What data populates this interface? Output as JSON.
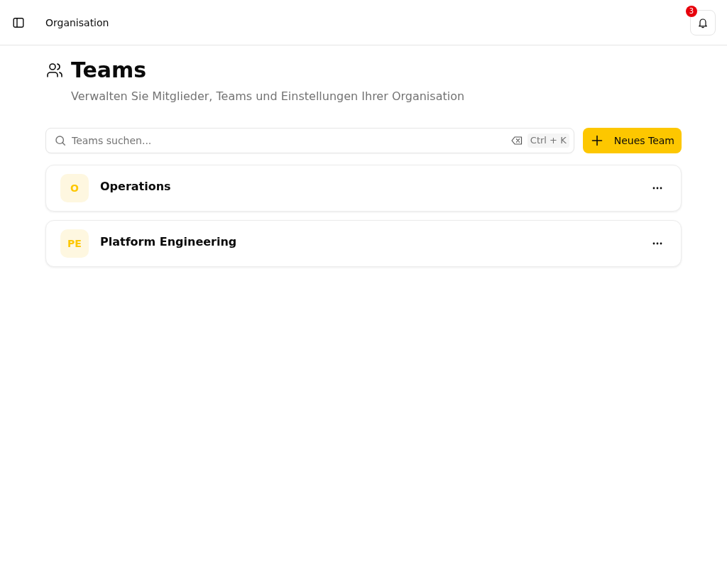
{
  "header": {
    "breadcrumb": "Organisation",
    "notifications": {
      "count": "3"
    }
  },
  "page": {
    "title": "Teams",
    "subtitle": "Verwalten Sie Mitglieder, Teams und Einstellungen Ihrer Organisation"
  },
  "toolbar": {
    "search": {
      "placeholder": "Teams suchen...",
      "shortcut": "Ctrl + K"
    },
    "new_button": {
      "label": "Neues Team"
    }
  },
  "teams": [
    {
      "initials": "O",
      "name": "Operations"
    },
    {
      "initials": "PE",
      "name": "Platform Engineering"
    }
  ]
}
